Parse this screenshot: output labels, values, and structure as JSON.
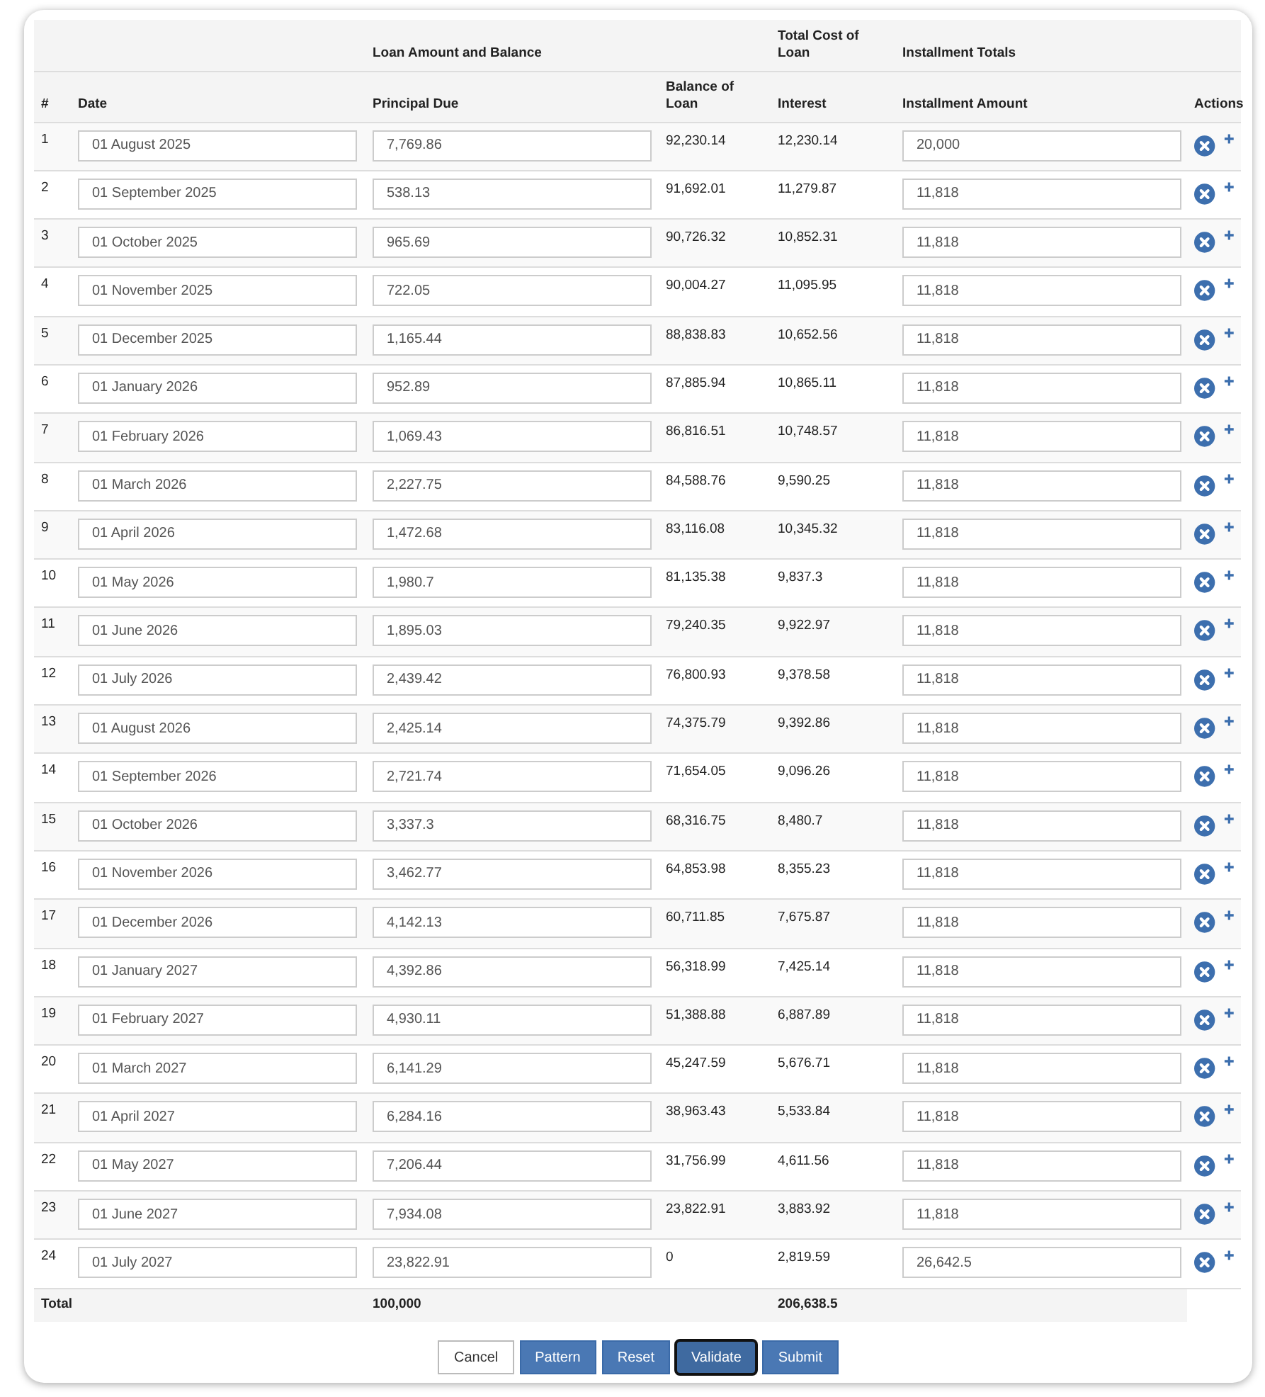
{
  "table": {
    "columns": [
      {
        "label": "#"
      },
      {
        "label": "Date"
      },
      {
        "label": "Principal Due",
        "group": "Loan Amount and Balance"
      },
      {
        "label": "Balance of Loan"
      },
      {
        "label": "Interest",
        "group": "Total Cost of Loan"
      },
      {
        "label": "Installment Amount",
        "group": "Installment Totals"
      },
      {
        "label": "Actions"
      }
    ],
    "rows": [
      {
        "number": "1",
        "date": "01 August 2025",
        "principal": "7,769.86",
        "balance": "92,230.14",
        "interest": "12,230.14",
        "installment": "20,000"
      },
      {
        "number": "2",
        "date": "01 September 2025",
        "principal": "538.13",
        "balance": "91,692.01",
        "interest": "11,279.87",
        "installment": "11,818"
      },
      {
        "number": "3",
        "date": "01 October 2025",
        "principal": "965.69",
        "balance": "90,726.32",
        "interest": "10,852.31",
        "installment": "11,818"
      },
      {
        "number": "4",
        "date": "01 November 2025",
        "principal": "722.05",
        "balance": "90,004.27",
        "interest": "11,095.95",
        "installment": "11,818"
      },
      {
        "number": "5",
        "date": "01 December 2025",
        "principal": "1,165.44",
        "balance": "88,838.83",
        "interest": "10,652.56",
        "installment": "11,818"
      },
      {
        "number": "6",
        "date": "01 January 2026",
        "principal": "952.89",
        "balance": "87,885.94",
        "interest": "10,865.11",
        "installment": "11,818"
      },
      {
        "number": "7",
        "date": "01 February 2026",
        "principal": "1,069.43",
        "balance": "86,816.51",
        "interest": "10,748.57",
        "installment": "11,818"
      },
      {
        "number": "8",
        "date": "01 March 2026",
        "principal": "2,227.75",
        "balance": "84,588.76",
        "interest": "9,590.25",
        "installment": "11,818"
      },
      {
        "number": "9",
        "date": "01 April 2026",
        "principal": "1,472.68",
        "balance": "83,116.08",
        "interest": "10,345.32",
        "installment": "11,818"
      },
      {
        "number": "10",
        "date": "01 May 2026",
        "principal": "1,980.7",
        "balance": "81,135.38",
        "interest": "9,837.3",
        "installment": "11,818"
      },
      {
        "number": "11",
        "date": "01 June 2026",
        "principal": "1,895.03",
        "balance": "79,240.35",
        "interest": "9,922.97",
        "installment": "11,818"
      },
      {
        "number": "12",
        "date": "01 July 2026",
        "principal": "2,439.42",
        "balance": "76,800.93",
        "interest": "9,378.58",
        "installment": "11,818"
      },
      {
        "number": "13",
        "date": "01 August 2026",
        "principal": "2,425.14",
        "balance": "74,375.79",
        "interest": "9,392.86",
        "installment": "11,818"
      },
      {
        "number": "14",
        "date": "01 September 2026",
        "principal": "2,721.74",
        "balance": "71,654.05",
        "interest": "9,096.26",
        "installment": "11,818"
      },
      {
        "number": "15",
        "date": "01 October 2026",
        "principal": "3,337.3",
        "balance": "68,316.75",
        "interest": "8,480.7",
        "installment": "11,818"
      },
      {
        "number": "16",
        "date": "01 November 2026",
        "principal": "3,462.77",
        "balance": "64,853.98",
        "interest": "8,355.23",
        "installment": "11,818"
      },
      {
        "number": "17",
        "date": "01 December 2026",
        "principal": "4,142.13",
        "balance": "60,711.85",
        "interest": "7,675.87",
        "installment": "11,818"
      },
      {
        "number": "18",
        "date": "01 January 2027",
        "principal": "4,392.86",
        "balance": "56,318.99",
        "interest": "7,425.14",
        "installment": "11,818"
      },
      {
        "number": "19",
        "date": "01 February 2027",
        "principal": "4,930.11",
        "balance": "51,388.88",
        "interest": "6,887.89",
        "installment": "11,818"
      },
      {
        "number": "20",
        "date": "01 March 2027",
        "principal": "6,141.29",
        "balance": "45,247.59",
        "interest": "5,676.71",
        "installment": "11,818"
      },
      {
        "number": "21",
        "date": "01 April 2027",
        "principal": "6,284.16",
        "balance": "38,963.43",
        "interest": "5,533.84",
        "installment": "11,818"
      },
      {
        "number": "22",
        "date": "01 May 2027",
        "principal": "7,206.44",
        "balance": "31,756.99",
        "interest": "4,611.56",
        "installment": "11,818"
      },
      {
        "number": "23",
        "date": "01 June 2027",
        "principal": "7,934.08",
        "balance": "23,822.91",
        "interest": "3,883.92",
        "installment": "11,818"
      },
      {
        "number": "24",
        "date": "01 July 2027",
        "principal": "23,822.91",
        "balance": "0",
        "interest": "2,819.59",
        "installment": "26,642.5"
      }
    ],
    "total": {
      "label": "Total",
      "principal": "100,000",
      "interest": "206,638.5"
    }
  },
  "buttons": [
    {
      "label": "Cancel",
      "kind": "outline",
      "focused": false
    },
    {
      "label": "Pattern",
      "kind": "primary",
      "focused": false
    },
    {
      "label": "Reset",
      "kind": "primary",
      "focused": false
    },
    {
      "label": "Validate",
      "kind": "primary",
      "focused": true
    },
    {
      "label": "Submit",
      "kind": "primary",
      "focused": false
    }
  ]
}
